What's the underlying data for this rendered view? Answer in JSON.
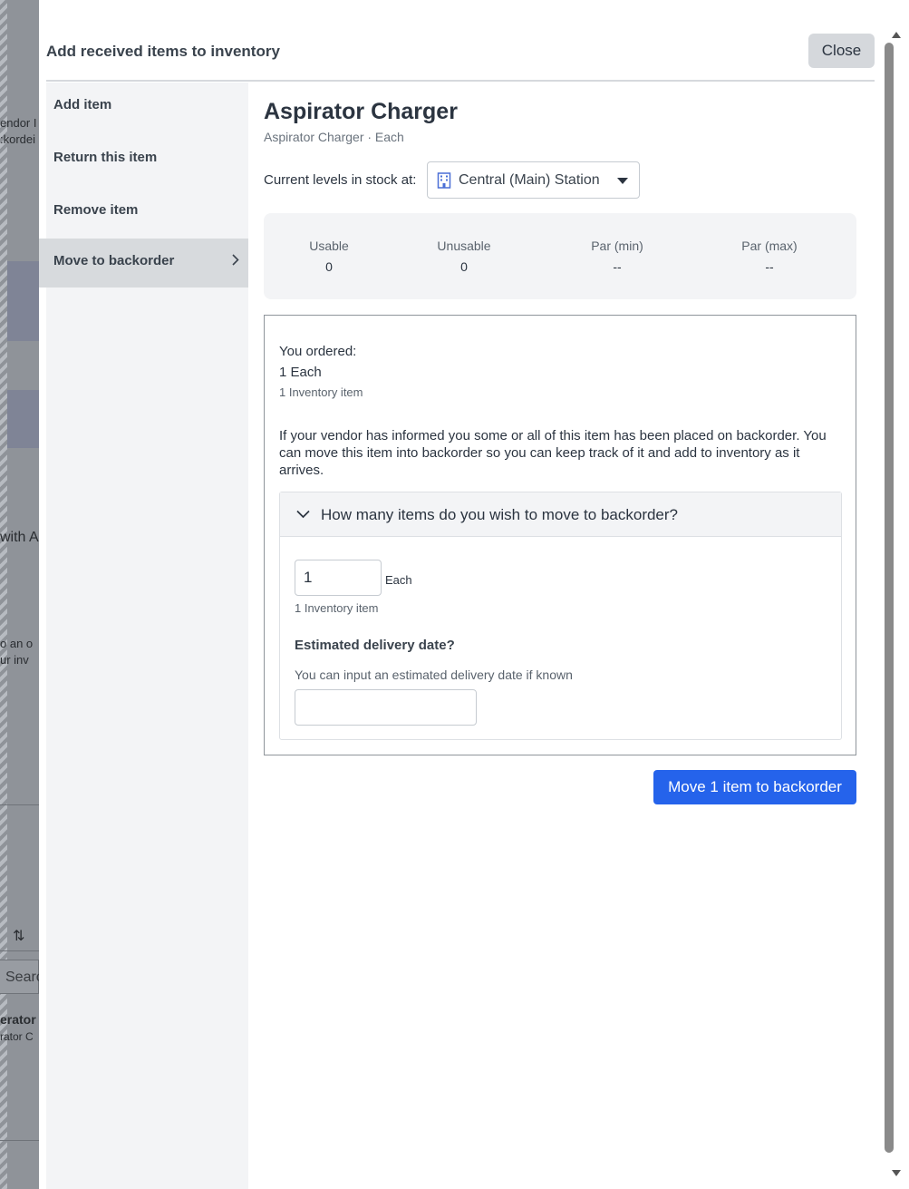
{
  "background": {
    "fragments": [
      "endor I",
      ":kordei",
      "with A",
      "o an o",
      "ur inv",
      "erator",
      "rator C",
      "Searc"
    ]
  },
  "modal": {
    "title": "Add received items to inventory",
    "close_label": "Close"
  },
  "sidebar": {
    "items": [
      {
        "label": "Add item"
      },
      {
        "label": "Return this item"
      },
      {
        "label": "Remove item"
      },
      {
        "label": "Move to backorder",
        "active": true
      }
    ]
  },
  "item": {
    "title": "Aspirator Charger",
    "subtitle": "Aspirator Charger · Each"
  },
  "stock": {
    "label": "Current levels in stock at:",
    "station": "Central (Main) Station",
    "station_icon": "building-icon",
    "stats": [
      {
        "label": "Usable",
        "value": "0"
      },
      {
        "label": "Unusable",
        "value": "0"
      },
      {
        "label": "Par (min)",
        "value": "--"
      },
      {
        "label": "Par (max)",
        "value": "--"
      }
    ]
  },
  "order": {
    "label": "You ordered:",
    "quantity": "1 Each",
    "inventory": "1 Inventory item",
    "info": "If your vendor has informed you some or all of this item has been placed on backorder. You can move this item into backorder so you can keep track of it and add to inventory as it arrives."
  },
  "backorder": {
    "question": "How many items do you wish to move to backorder?",
    "quantity_value": "1",
    "unit": "Each",
    "inventory": "1 Inventory item",
    "date_label": "Estimated delivery date?",
    "date_hint": "You can input an estimated delivery date if known",
    "date_value": "",
    "submit_label": "Move 1 item to backorder"
  },
  "colors": {
    "accent": "#2563eb",
    "active_sidebar": "#d7dadd",
    "panel_bg": "#f3f4f6"
  }
}
